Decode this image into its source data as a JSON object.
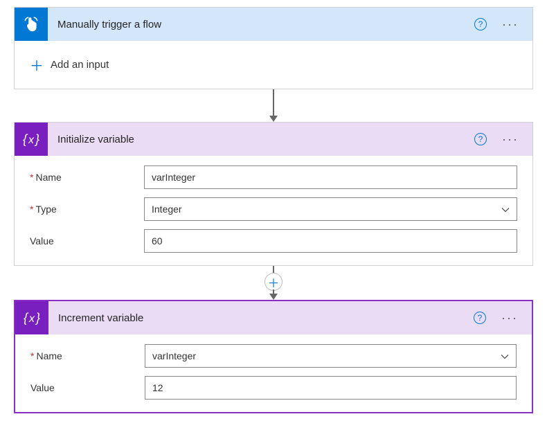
{
  "cards": {
    "trigger": {
      "title": "Manually trigger a flow",
      "add_input_label": "Add an input"
    },
    "init_var": {
      "title": "Initialize variable",
      "fields": {
        "name_label": "Name",
        "name_value": "varInteger",
        "type_label": "Type",
        "type_value": "Integer",
        "value_label": "Value",
        "value_value": "60"
      }
    },
    "incr_var": {
      "title": "Increment variable",
      "fields": {
        "name_label": "Name",
        "name_value": "varInteger",
        "value_label": "Value",
        "value_value": "12"
      }
    }
  },
  "icons": {
    "help": "?",
    "more": "···",
    "plus": "＋",
    "add_step": "＋"
  }
}
